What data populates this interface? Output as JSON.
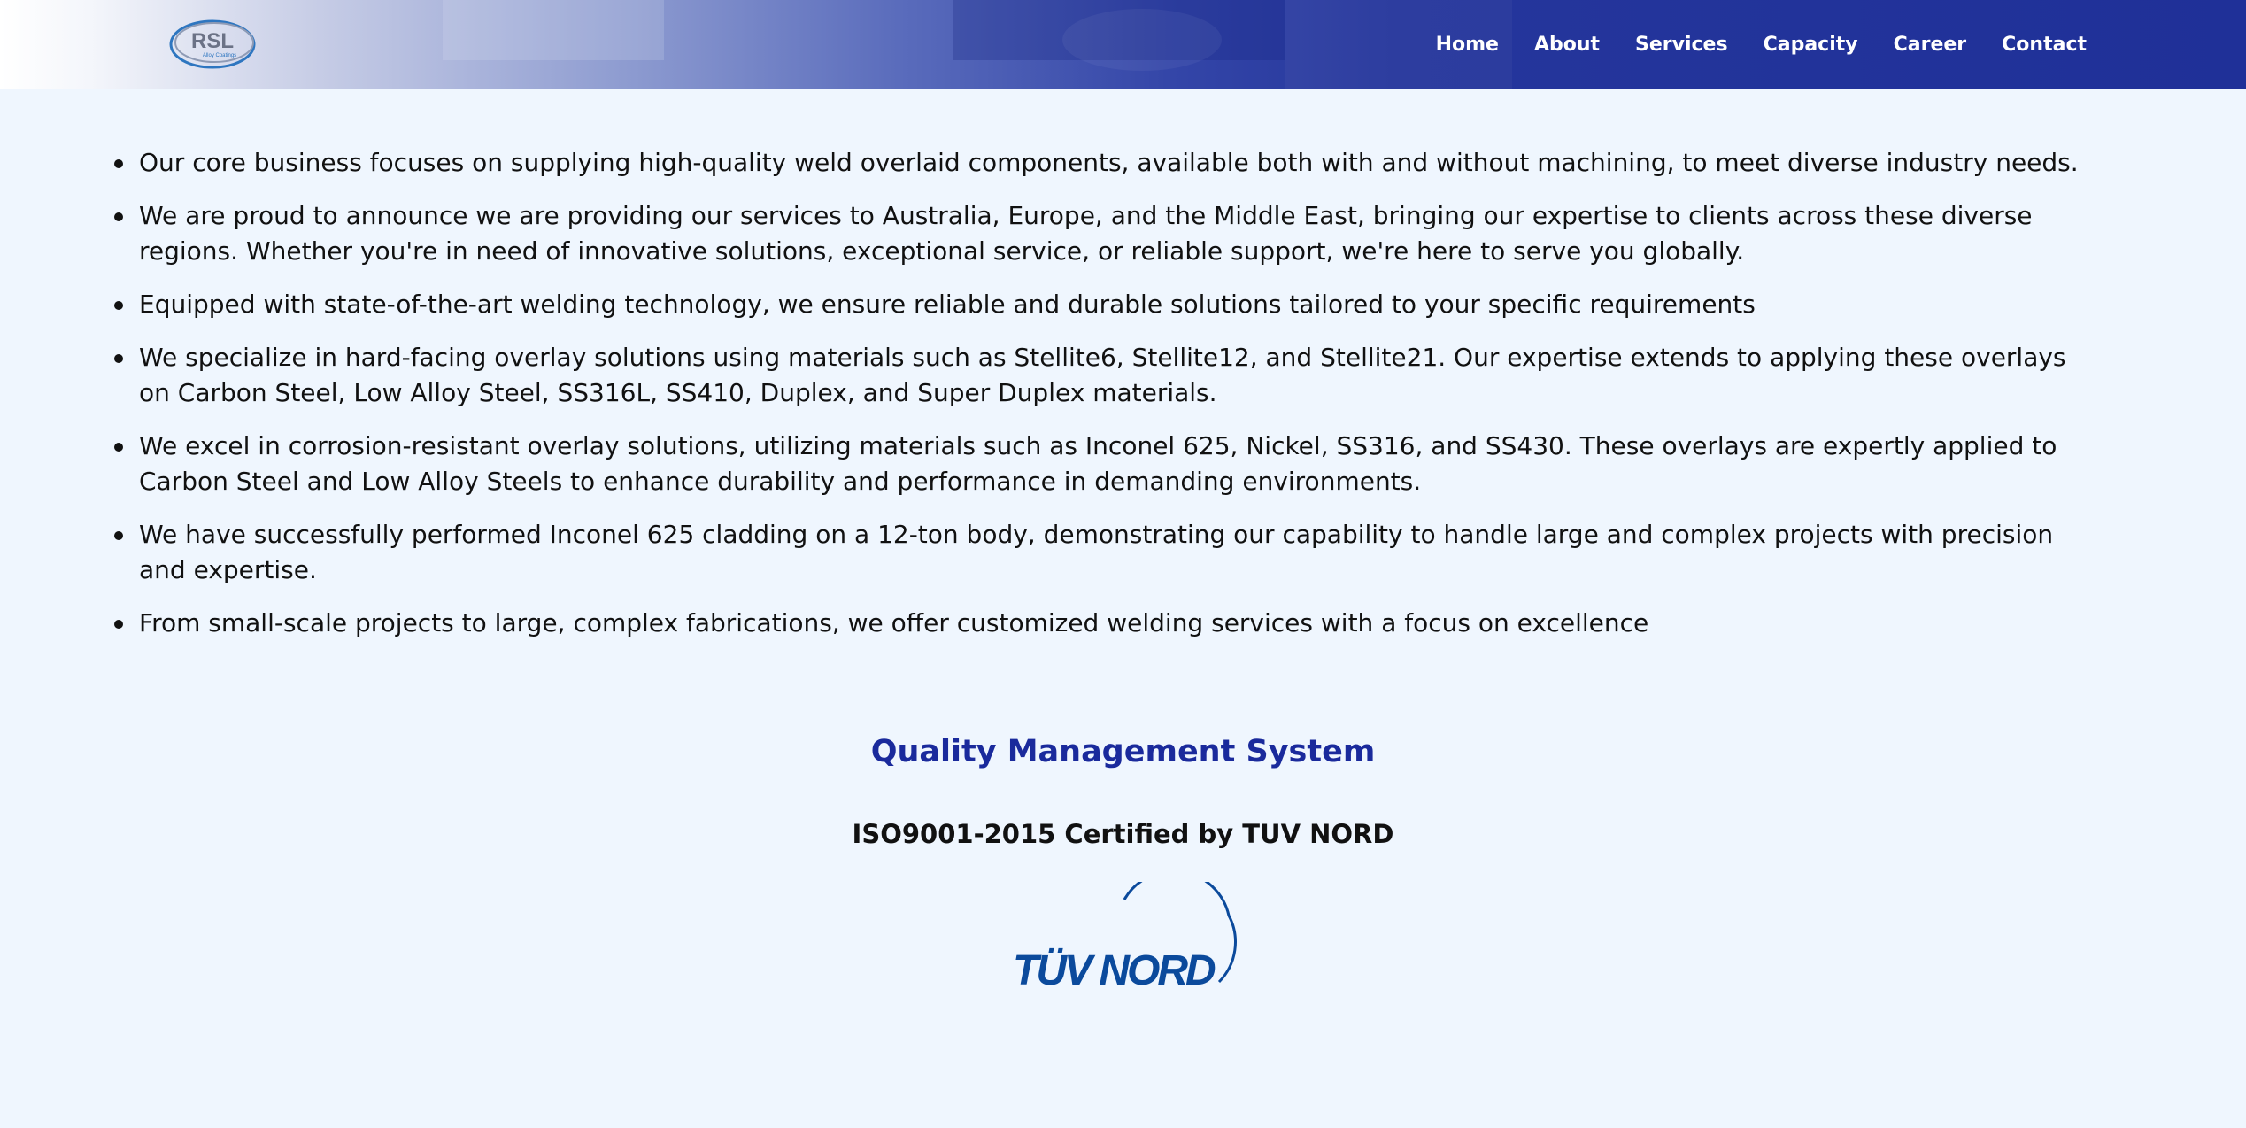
{
  "brand": {
    "logo_text": "RSL",
    "logo_subtext": "Alloy Coatings"
  },
  "nav": {
    "items": [
      {
        "label": "Home"
      },
      {
        "label": "About"
      },
      {
        "label": "Services"
      },
      {
        "label": "Capacity"
      },
      {
        "label": "Career"
      },
      {
        "label": "Contact"
      }
    ]
  },
  "content": {
    "bullets": [
      "Our core business focuses on supplying high-quality weld overlaid components, available both with and without machining, to meet diverse industry needs.",
      "We are proud to announce we are providing our services to Australia, Europe, and the Middle East, bringing our expertise to clients across these diverse regions. Whether you're in need of innovative solutions, exceptional service, or reliable support, we're here to serve you globally.",
      "Equipped with state-of-the-art welding technology, we ensure reliable and durable solutions tailored to your specific requirements",
      "We specialize in hard-facing overlay solutions using materials such as Stellite6, Stellite12, and Stellite21. Our expertise extends to applying these overlays on Carbon Steel, Low Alloy Steel, SS316L, SS410, Duplex, and Super Duplex materials.",
      "We excel in corrosion-resistant overlay solutions, utilizing materials such as Inconel 625, Nickel, SS316, and SS430. These overlays are expertly applied to Carbon Steel and Low Alloy Steels to enhance durability and performance in demanding environments.",
      "We have successfully performed Inconel 625 cladding on a 12-ton body, demonstrating our capability to handle large and complex projects with precision and expertise.",
      "From small-scale projects to large, complex fabrications, we offer customized welding services with a focus on excellence"
    ]
  },
  "qms": {
    "title": "Quality Management System",
    "certification": "ISO9001-2015 Certified by TUV NORD",
    "logo_text": "TÜV NORD"
  },
  "colors": {
    "header_dark": "#1f3098",
    "accent_blue": "#1a2a9c",
    "page_background": "#eff6fe",
    "tuv_blue": "#0b4a9c"
  }
}
